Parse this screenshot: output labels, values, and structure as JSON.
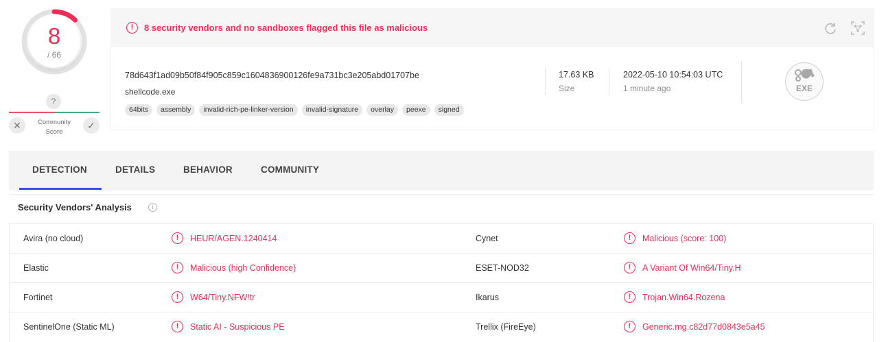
{
  "score": {
    "detections": "8",
    "total": "/ 66",
    "ratio": 0.1212,
    "color": "#f12c54"
  },
  "community": {
    "question_mark": "?",
    "label_line1": "Community",
    "label_line2": "Score",
    "vote_down_glyph": "✕",
    "vote_up_glyph": "✓"
  },
  "alert": {
    "icon_glyph": "!",
    "text": "8 security vendors and no sandboxes flagged this file as malicious",
    "color": "#f12c54"
  },
  "file": {
    "hash": "78d643f1ad09b50f84f905c859c1604836900126fe9a731bc3e205abd01707be",
    "name": "shellcode.exe",
    "tags": [
      "64bits",
      "assembly",
      "invalid-rich-pe-linker-version",
      "invalid-signature",
      "overlay",
      "peexe",
      "signed"
    ],
    "size_value": "17.63 KB",
    "size_label": "Size",
    "date_value": "2022-05-10 10:54:03 UTC",
    "date_label": "1 minute ago",
    "type_icon_text": "EXE",
    "type_icon_name": "exe-file-icon"
  },
  "tabs": [
    {
      "label": "DETECTION",
      "active": true
    },
    {
      "label": "DETAILS",
      "active": false
    },
    {
      "label": "BEHAVIOR",
      "active": false
    },
    {
      "label": "COMMUNITY",
      "active": false
    }
  ],
  "accent_color": "#3a4ff2",
  "vendors_section": {
    "title": "Security Vendors' Analysis",
    "info_glyph": "i",
    "rows": [
      {
        "left_vendor": "Avira (no cloud)",
        "left_result": "HEUR/AGEN.1240414",
        "right_vendor": "Cynet",
        "right_result": "Malicious (score: 100)"
      },
      {
        "left_vendor": "Elastic",
        "left_result": "Malicious (high Confidence)",
        "right_vendor": "ESET-NOD32",
        "right_result": "A Variant Of Win64/Tiny.H"
      },
      {
        "left_vendor": "Fortinet",
        "left_result": "W64/Tiny.NFW!tr",
        "right_vendor": "Ikarus",
        "right_result": "Trojan.Win64.Rozena"
      },
      {
        "left_vendor": "SentinelOne (Static ML)",
        "left_result": "Static AI - Suspicious PE",
        "right_vendor": "Trellix (FireEye)",
        "right_result": "Generic.mg.c82d77d0843e5a45"
      }
    ],
    "alert_glyph": "!"
  }
}
